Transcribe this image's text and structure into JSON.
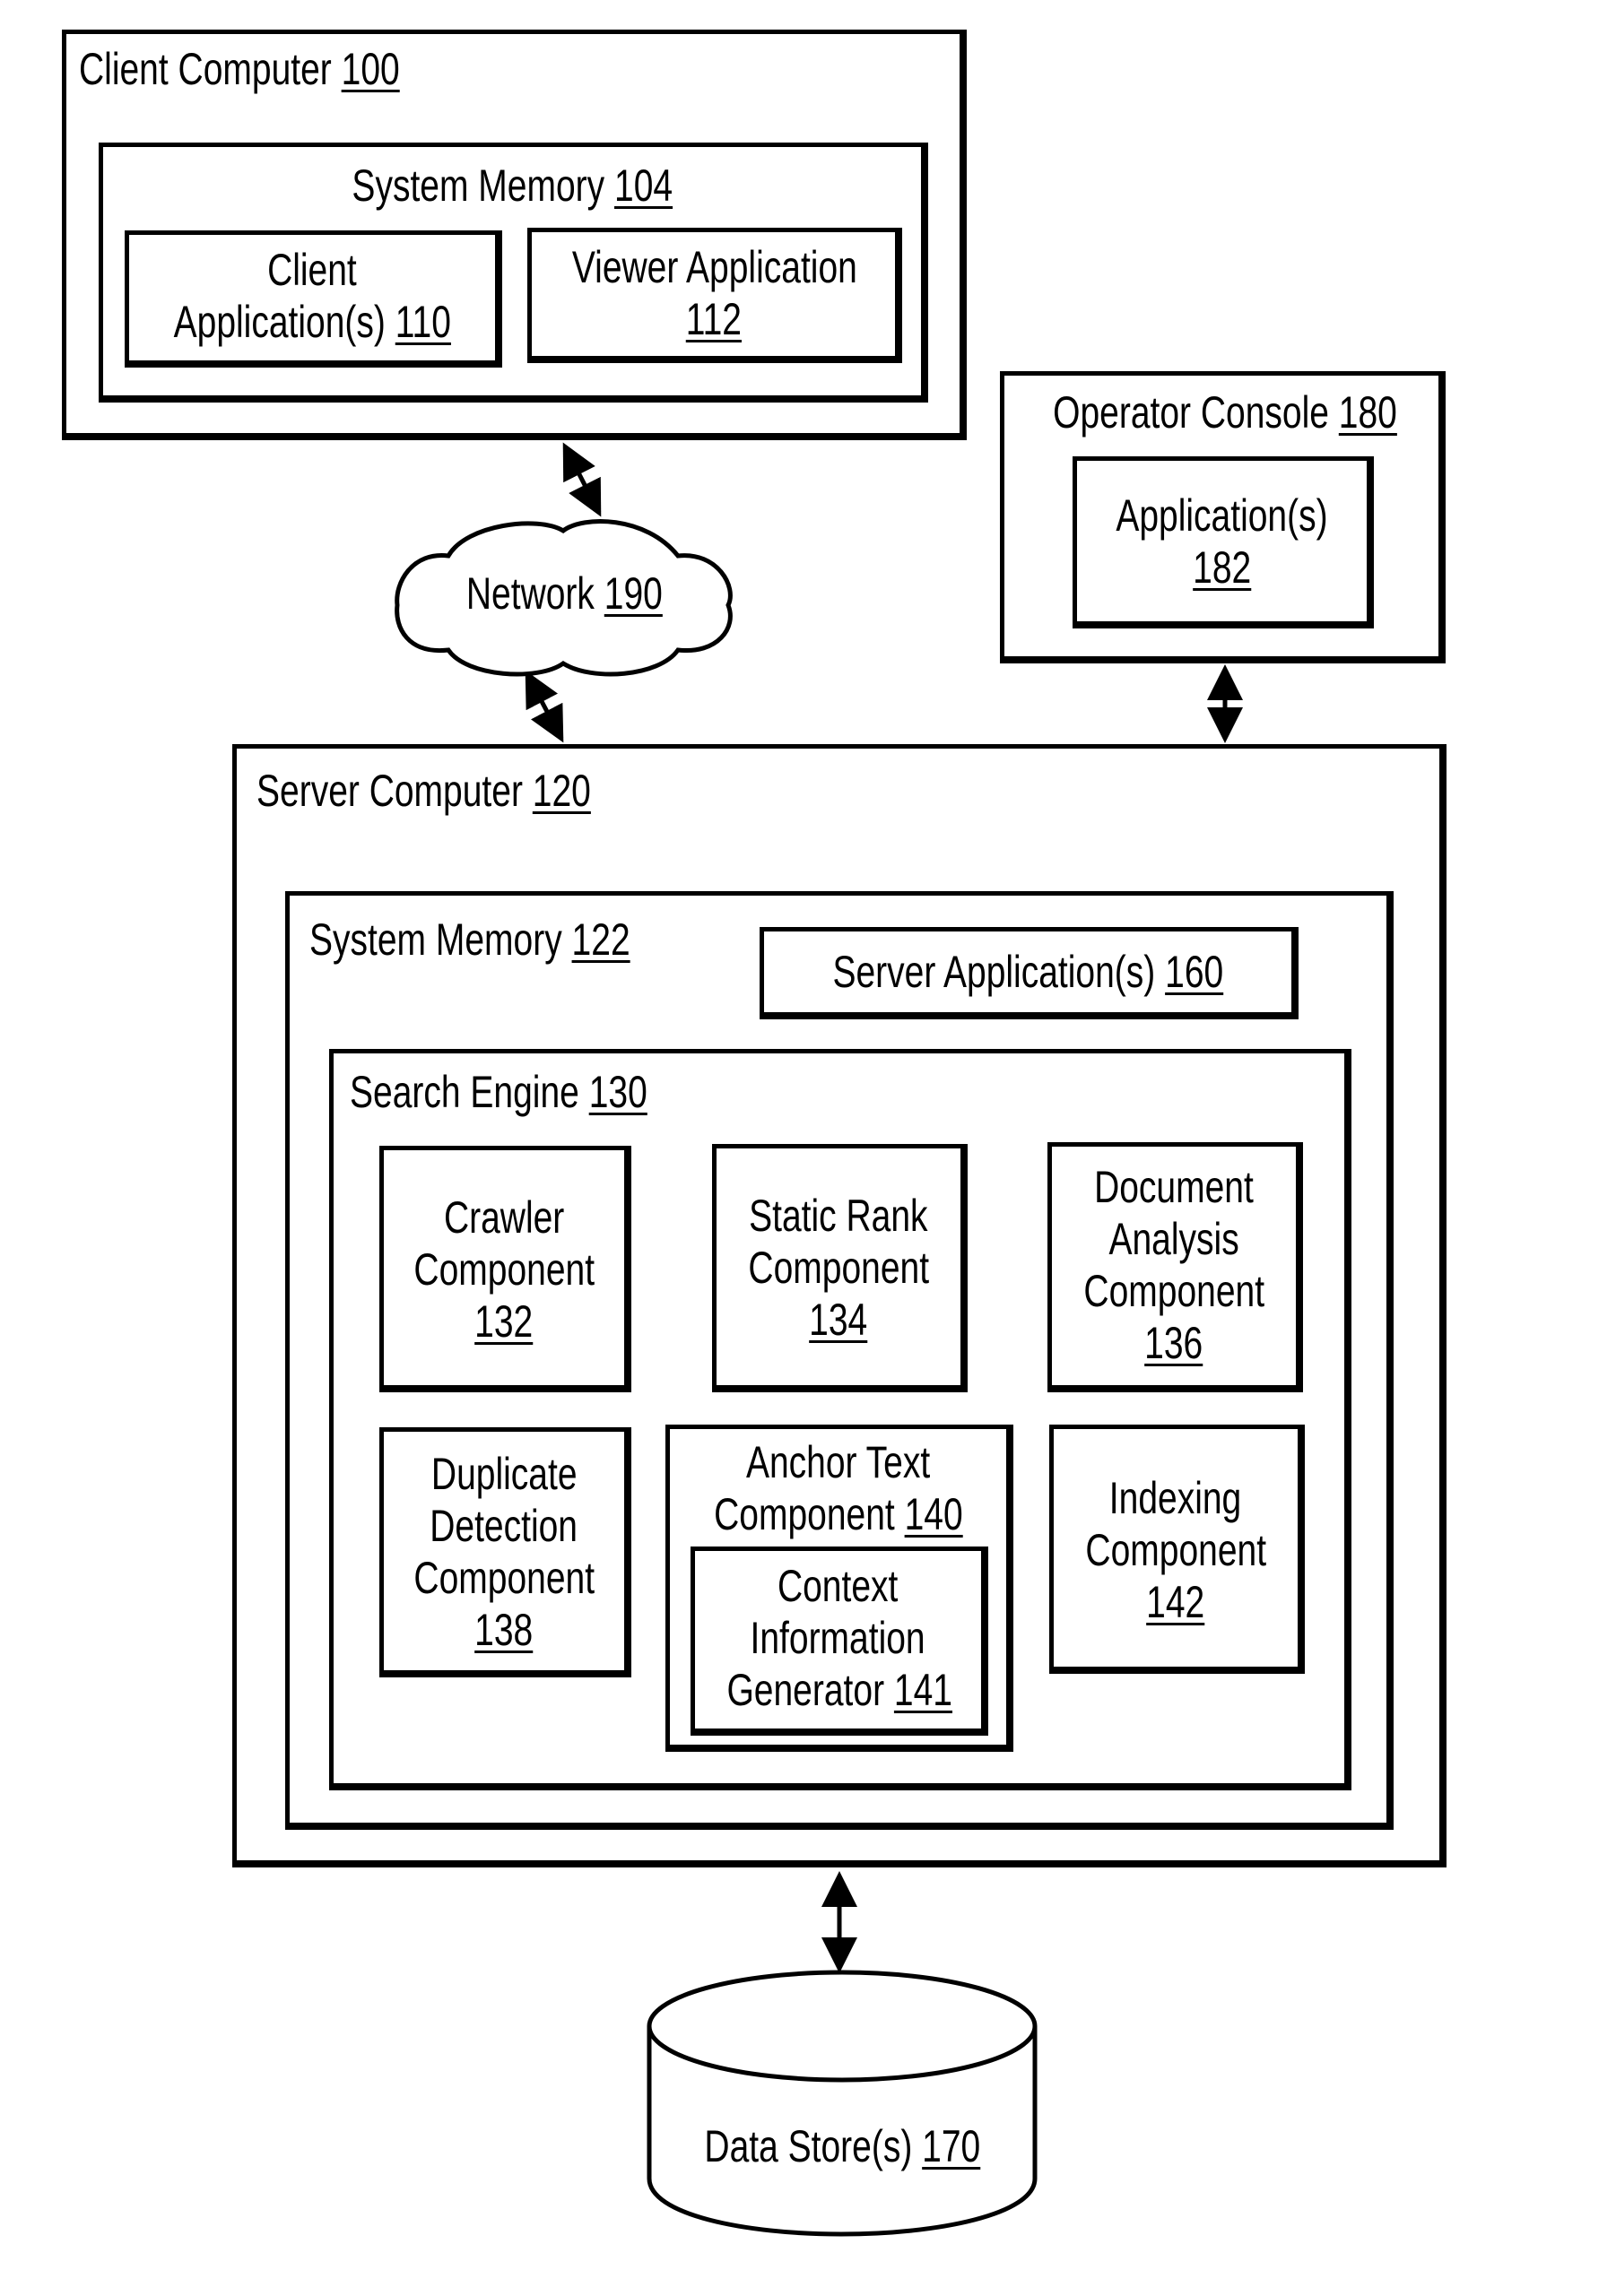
{
  "client_computer": {
    "title": "Client Computer",
    "ref": "100",
    "system_memory": {
      "title": "System Memory",
      "ref": "104",
      "client_apps": {
        "line1": "Client",
        "line2": "Application(s)",
        "ref": "110"
      },
      "viewer_app": {
        "line1": "Viewer Application",
        "ref": "112"
      }
    }
  },
  "operator_console": {
    "title": "Operator Console",
    "ref": "180",
    "applications": {
      "line1": "Application(s)",
      "ref": "182"
    }
  },
  "network": {
    "title": "Network",
    "ref": "190"
  },
  "server_computer": {
    "title": "Server Computer",
    "ref": "120",
    "system_memory": {
      "title": "System Memory",
      "ref": "122",
      "server_apps": {
        "title": "Server Application(s)",
        "ref": "160"
      },
      "search_engine": {
        "title": "Search Engine",
        "ref": "130",
        "components": {
          "crawler": {
            "line1": "Crawler",
            "line2": "Component",
            "ref": "132"
          },
          "static_rank": {
            "line1": "Static Rank",
            "line2": "Component",
            "ref": "134"
          },
          "document_analysis": {
            "line1": "Document",
            "line2": "Analysis",
            "line3": "Component",
            "ref": "136"
          },
          "duplicate_detection": {
            "line1": "Duplicate",
            "line2": "Detection",
            "line3": "Component",
            "ref": "138"
          },
          "anchor_text": {
            "line1": "Anchor Text",
            "line2": "Component",
            "ref": "140",
            "context_generator": {
              "line1": "Context",
              "line2": "Information",
              "line3": "Generator",
              "ref": "141"
            }
          },
          "indexing": {
            "line1": "Indexing",
            "line2": "Component",
            "ref": "142"
          }
        }
      }
    }
  },
  "data_store": {
    "title": "Data Store(s)",
    "ref": "170"
  },
  "connections": [
    {
      "from": "client_computer",
      "to": "network",
      "type": "bidirectional"
    },
    {
      "from": "network",
      "to": "server_computer",
      "type": "bidirectional"
    },
    {
      "from": "operator_console",
      "to": "server_computer",
      "type": "bidirectional"
    },
    {
      "from": "server_computer",
      "to": "data_store",
      "type": "bidirectional"
    }
  ]
}
